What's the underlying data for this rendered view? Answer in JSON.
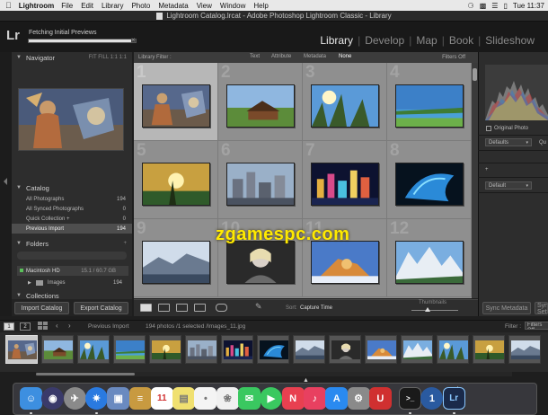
{
  "menubar": {
    "app": "Lightroom",
    "items": [
      "File",
      "Edit",
      "Library",
      "Photo",
      "Metadata",
      "View",
      "Window",
      "Help"
    ],
    "clock": "Tue 11:37"
  },
  "window": {
    "title": "Lightroom Catalog.lrcat - Adobe Photoshop Lightroom Classic - Library"
  },
  "identity": {
    "logo": "Lr",
    "progress_label": "Fetching Initial Previews",
    "progress_value": 0.96,
    "modules": [
      "Library",
      "Develop",
      "Map",
      "Book",
      "Slideshow"
    ],
    "active_module": "Library"
  },
  "navigator": {
    "title": "Navigator",
    "zoom_modes": "FIT  FILL  1:1  1:1"
  },
  "catalog": {
    "title": "Catalog",
    "items": [
      {
        "label": "All Photographs",
        "count": "194"
      },
      {
        "label": "All Synced Photographs",
        "count": "0"
      },
      {
        "label": "Quick Collection +",
        "count": "0"
      },
      {
        "label": "Previous Import",
        "count": "194"
      }
    ]
  },
  "folders": {
    "title": "Folders",
    "add": "+",
    "volume": {
      "name": "Macintosh HD",
      "stats": "15.1 / 60.7 GB"
    },
    "folder": {
      "name": "Images",
      "count": "194"
    }
  },
  "collections": {
    "title": "Collections"
  },
  "left_buttons": {
    "import": "Import Catalog",
    "export": "Export Catalog"
  },
  "filter": {
    "label": "Library Filter :",
    "tabs": [
      "Text",
      "Attribute",
      "Metadata",
      "None"
    ],
    "active": "None",
    "off": "Filters Off"
  },
  "grid": {
    "cells": [
      "1",
      "2",
      "3",
      "4",
      "5",
      "6",
      "7",
      "8",
      "9",
      "10",
      "11",
      "12"
    ],
    "selected_index": 0
  },
  "toolbar": {
    "sort_label": "Sort:",
    "sort_value": "Capture Time",
    "thumbs_label": "Thumbnails",
    "thumb_size": 0.35
  },
  "watermark": "zgamespc.com",
  "right_panel": {
    "original_photo": "Original Photo",
    "defaults": "Defaults",
    "quick_develop": "Qu",
    "default": "Default",
    "add": "+"
  },
  "sync": {
    "metadata": "Sync Metadata",
    "settings": "Sync Settings"
  },
  "filmstrip": {
    "pages": [
      "1",
      "2"
    ],
    "source": "Previous Import",
    "info": "194 photos /1 selected /Images_11.jpg",
    "filter_label": "Filter :",
    "filter_value": "Filters Off",
    "count": 15,
    "selected_index": 0
  },
  "dock": {
    "icons": [
      "finder-icon",
      "siri-icon",
      "launchpad-icon",
      "safari-icon",
      "photo-viewer-icon",
      "notes-icon",
      "calendar-icon",
      "stickies-icon",
      "reminders-icon",
      "photos-icon",
      "messages-icon",
      "facetime-icon",
      "news-icon",
      "music-icon",
      "appstore-icon",
      "settings-icon",
      "magnet-icon",
      "terminal-icon",
      "1password-icon",
      "lightroom-icon"
    ],
    "calendar_day": "11"
  },
  "colors": {
    "accent": "#e8e8e8",
    "panel": "#2d2d2d",
    "grid_bg": "#8f8f8f",
    "watermark": "#ffea00"
  }
}
